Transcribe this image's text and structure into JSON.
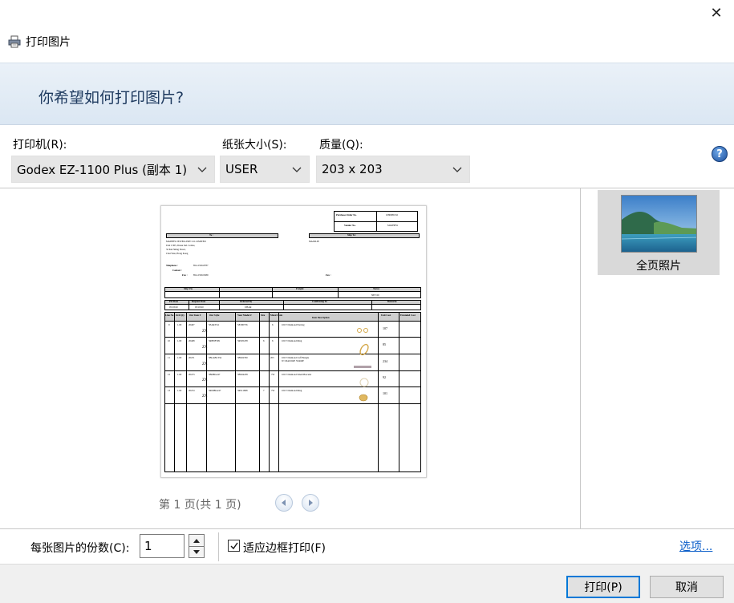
{
  "window": {
    "title": "打印图片",
    "close_glyph": "✕"
  },
  "header": {
    "question": "你希望如何打印图片?"
  },
  "options": {
    "printer_label": "打印机(R):",
    "printer_value": "Godex EZ-1100 Plus (副本 1)",
    "paper_label": "纸张大小(S):",
    "paper_value": "USER",
    "quality_label": "质量(Q):",
    "quality_value": "203 x 203",
    "help_glyph": "?"
  },
  "preview": {
    "page_info": "第 1 页(共 1 页)",
    "document": {
      "po_label": "Purchase Order No.",
      "po_value": "1080089132",
      "vendor_label": "Vendor No.",
      "vendor_value": "MATHEW",
      "to_header": "To :",
      "ship_to_header": "Ship To:",
      "to_lines": [
        "MATHEW JEWELLERY CO. LIMITED",
        "Unit C305, Dassa Ind. Centre,",
        "32 Kui Shing Street,",
        "Chai Wan, Hong Kong"
      ],
      "ship_to_name": "MAJOLIE",
      "telephone_label": "Telephone :",
      "telephone_value": "852-2330-8787",
      "contact_label": "Contact :",
      "fax_label": "Fax :",
      "fax_value": "852-2330-9589",
      "fax_label_right": "Fax :",
      "ship_via": "Ship Via",
      "freight": "Freight",
      "terms": "Terms",
      "terms_value": "NET 60",
      "po_date": "PO Date",
      "request_date": "Request Date",
      "ordered_by": "Ordered By",
      "confirming_to": "Confirming To",
      "remarks": "Remarks",
      "po_date_value": "05/18/20",
      "request_date_value": "05/18/20",
      "ordered_by_value": "UHAR",
      "columns": [
        "Line No",
        "Ord Qty",
        "Our Item #",
        "Our Style",
        "Your Model #",
        "Size",
        "Metal Code",
        "Item Description",
        "Unit Cost",
        "Extended Cost"
      ],
      "rows": [
        {
          "line": "9",
          "qty": "1.00",
          "item": "20467",
          "style": "ZX",
          "our_style": "5EAR3511",
          "model": "SE300756",
          "size": "",
          "metal": "6",
          "desc": "10CT Diamond Earring",
          "cost": "107"
        },
        {
          "line": "10",
          "qty": "1.00",
          "item": "20468",
          "style": "ZX",
          "our_style": "5RBNF599",
          "model": "5RS05238",
          "size": "6",
          "metal": "6",
          "desc": "10CT Diamond Ring",
          "cost": "85"
        },
        {
          "line": "11",
          "qty": "1.00",
          "item": "20471",
          "style": "ZX",
          "our_style": "5BLABC334",
          "model": "5BS02760",
          "size": "",
          "metal": "203",
          "desc": "10CT Diamond Cuff Bangle",
          "desc2": "W/ MAJOLIE STAMP",
          "cost": "234"
        },
        {
          "line": "12",
          "qty": "1.00",
          "item": "20473",
          "style": "ZX",
          "our_style": "5BDBG247",
          "model": "5BS04238",
          "size": "",
          "metal": "7W",
          "desc": "10CT Diamond Small Bracelet",
          "cost": "92"
        },
        {
          "line": "13",
          "qty": "1.00",
          "item": "20474",
          "style": "ZX",
          "our_style": "5RDIBG247",
          "model": "5RS11808",
          "size": "7",
          "metal": "7W",
          "desc": "10CT Diamond Ring",
          "cost": "101"
        }
      ]
    }
  },
  "layout": {
    "selected_label": "全页照片"
  },
  "copies": {
    "label": "每张图片的份数(C):",
    "value": "1"
  },
  "fit": {
    "label": "适应边框打印(F)",
    "checked": true
  },
  "links": {
    "options": "选项..."
  },
  "buttons": {
    "print": "打印(P)",
    "cancel": "取消"
  }
}
